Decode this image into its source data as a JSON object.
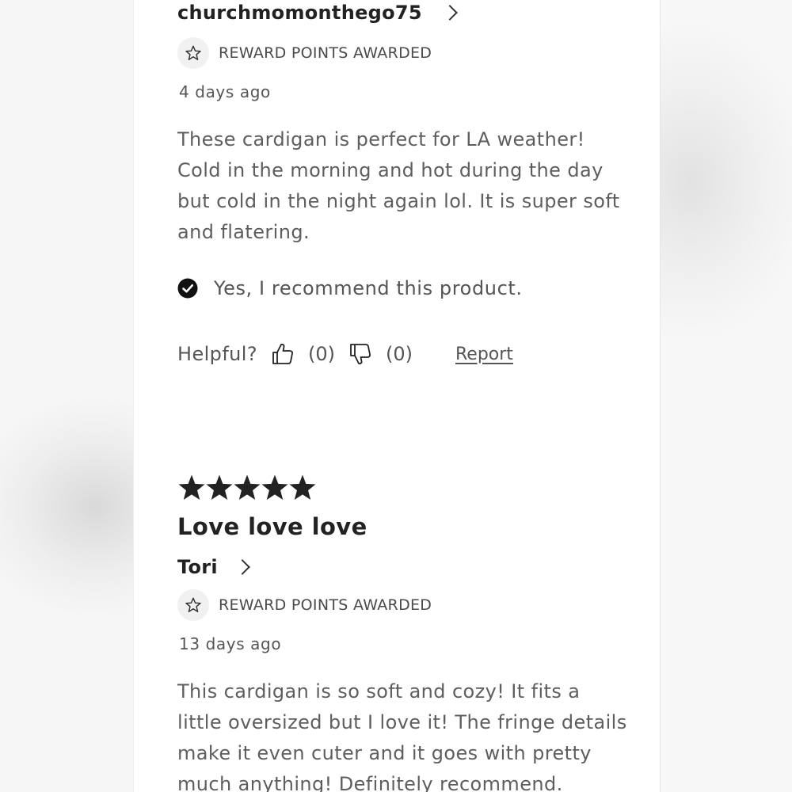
{
  "reviews": [
    {
      "author": "churchmomonthego75",
      "award_label": "REWARD POINTS AWARDED",
      "date": "4 days ago",
      "body": "These cardigan is perfect for LA weather! Cold in the morning and hot during the day but cold in the night again lol. It is super soft and flatering.",
      "recommend_text": "Yes, I recommend this product.",
      "helpful_label": "Helpful?",
      "helpful_yes_count": "(0)",
      "helpful_no_count": "(0)",
      "report_label": "Report"
    },
    {
      "rating": 5,
      "title": "Love love love",
      "author": "Tori",
      "award_label": "REWARD POINTS AWARDED",
      "date": "13 days ago",
      "body": "This cardigan is so soft and cozy! It fits a little oversized but I love it! The fringe details make it even cuter and it goes with pretty much anything! Definitely recommend."
    }
  ],
  "colors": {
    "text_dark": "#222222",
    "text_muted": "#5e5e5e",
    "star_fill": "#222222"
  },
  "icons": [
    "chevron-right-icon",
    "star-outline-icon",
    "check-circle-icon",
    "thumbs-up-icon",
    "thumbs-down-icon",
    "star-icon"
  ]
}
